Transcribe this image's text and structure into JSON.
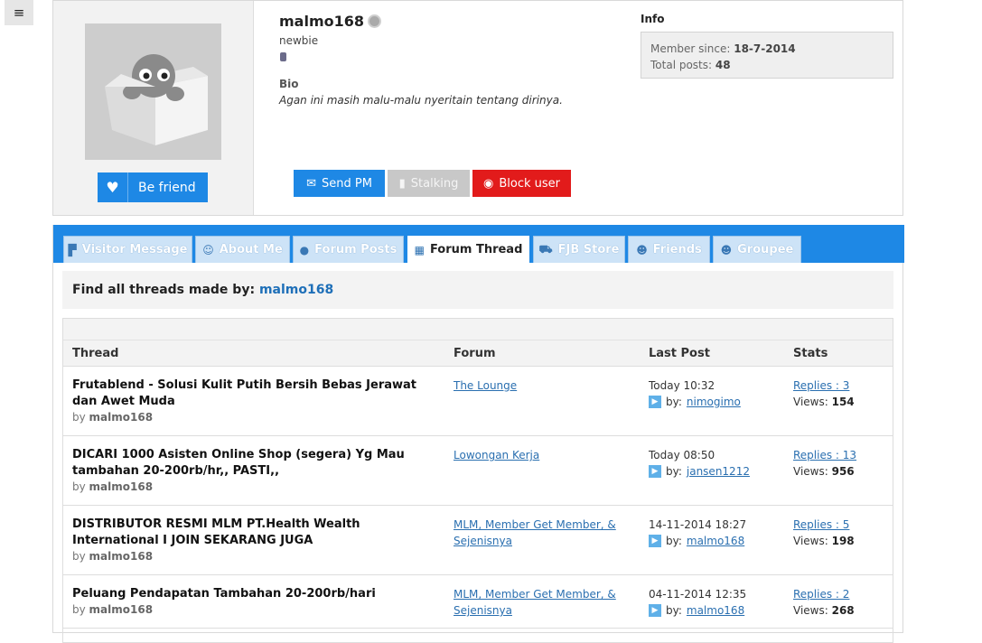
{
  "menu": {
    "icon": "hamburger-menu-icon",
    "glyph": "≡"
  },
  "profile": {
    "username": "malmo168",
    "rank": "newbie",
    "bio_title": "Bio",
    "bio_text": "Agan ini masih malu-malu nyeritain tentang dirinya.",
    "befriend_label": "Be friend",
    "info": {
      "title": "Info",
      "member_since_label": "Member since:",
      "member_since_value": "18-7-2014",
      "total_posts_label": "Total posts:",
      "total_posts_value": "48"
    },
    "buttons": {
      "send_pm": "Send PM",
      "stalking": "Stalking",
      "block_user": "Block user"
    }
  },
  "tabs": [
    {
      "label": "Visitor Message",
      "icon": "visitor-message-icon",
      "active": false
    },
    {
      "label": "About Me",
      "icon": "about-me-icon",
      "active": false
    },
    {
      "label": "Forum Posts",
      "icon": "forum-posts-icon",
      "active": false
    },
    {
      "label": "Forum Thread",
      "icon": "forum-thread-icon",
      "active": true
    },
    {
      "label": "FJB Store",
      "icon": "cart-icon",
      "active": false
    },
    {
      "label": "Friends",
      "icon": "friends-icon",
      "active": false
    },
    {
      "label": "Groupee",
      "icon": "groupee-icon",
      "active": false
    }
  ],
  "find": {
    "label": "Find all threads made by:",
    "user": "malmo168"
  },
  "table": {
    "headers": {
      "thread": "Thread",
      "forum": "Forum",
      "last_post": "Last Post",
      "stats": "Stats"
    },
    "rows": [
      {
        "title": "Frutablend - Solusi Kulit Putih Bersih Bebas Jerawat dan Awet Muda",
        "by_label": "by",
        "by_user": "malmo168",
        "forum": "The Lounge",
        "last_time": "Today 10:32",
        "last_by_label": "by:",
        "last_by_user": "nimogimo",
        "replies": "Replies : 3",
        "views_label": "Views:",
        "views": "154"
      },
      {
        "title": "DICARI 1000 Asisten Online Shop (segera) Yg Mau tambahan 20-200rb/hr,, PASTI,,",
        "by_label": "by",
        "by_user": "malmo168",
        "forum": "Lowongan Kerja",
        "last_time": "Today 08:50",
        "last_by_label": "by:",
        "last_by_user": "jansen1212",
        "replies": "Replies : 13",
        "views_label": "Views:",
        "views": "956"
      },
      {
        "title": "DISTRIBUTOR RESMI MLM PT.Health Wealth International I JOIN SEKARANG JUGA",
        "by_label": "by",
        "by_user": "malmo168",
        "forum": "MLM, Member Get Member, & Sejenisnya",
        "last_time": "14-11-2014 18:27",
        "last_by_label": "by:",
        "last_by_user": "malmo168",
        "replies": "Replies : 5",
        "views_label": "Views:",
        "views": "198"
      },
      {
        "title": "Peluang Pendapatan Tambahan 20-200rb/hari",
        "by_label": "by",
        "by_user": "malmo168",
        "forum": "MLM, Member Get Member, & Sejenisnya",
        "last_time": "04-11-2014 12:35",
        "last_by_label": "by:",
        "last_by_user": "malmo168",
        "replies": "Replies : 2",
        "views_label": "Views:",
        "views": "268"
      }
    ]
  }
}
